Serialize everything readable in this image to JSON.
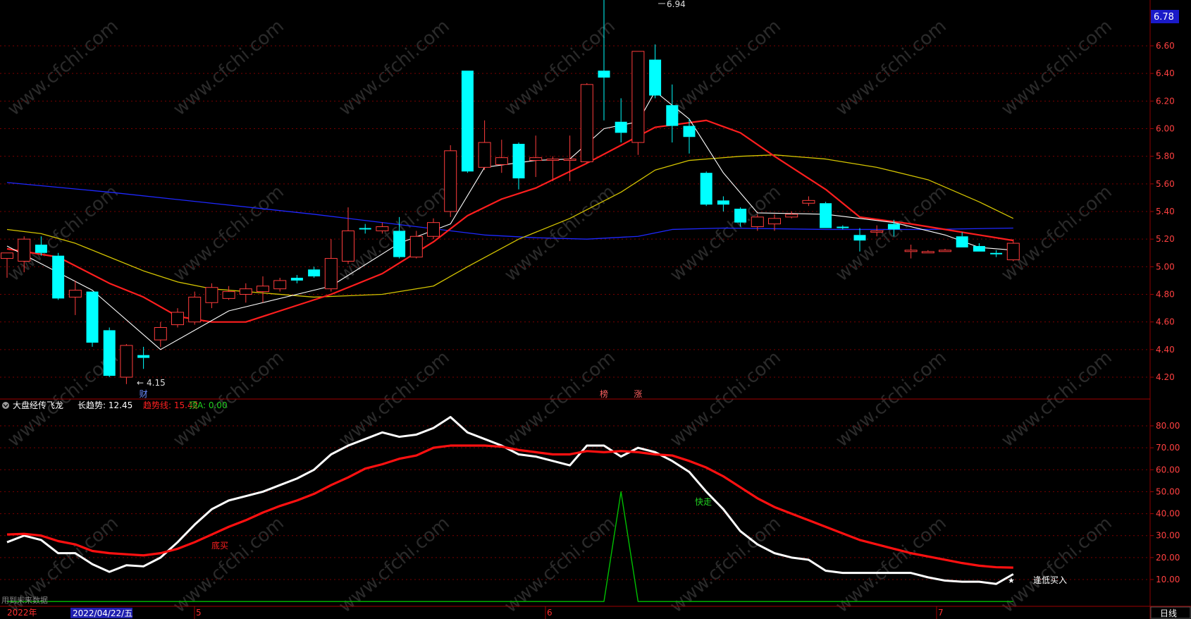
{
  "colors": {
    "bg": "#000000",
    "up": "#ff3c3c",
    "down": "#00ffff",
    "ma5": "#ffffff",
    "ma10": "#ff1e1e",
    "ma20": "#d4c400",
    "ma60": "#1e28ff",
    "grid": "#7a0000",
    "axis_text": "#ff4040",
    "signal": "#00c000",
    "white_line": "#ffffff",
    "red_line": "#ff1010"
  },
  "price_panel": {
    "current_price": "6.78",
    "high_label": "6.94",
    "low_label": "4.15",
    "y_ticks": [
      "6.60",
      "6.40",
      "6.20",
      "6.00",
      "5.80",
      "5.60",
      "5.40",
      "5.20",
      "5.00",
      "4.80",
      "4.60",
      "4.40",
      "4.20"
    ],
    "markers": [
      {
        "text": "财",
        "idx": 8
      },
      {
        "text": "榜",
        "idx": 35
      },
      {
        "text": "涨",
        "idx": 37
      }
    ]
  },
  "indicator_panel": {
    "title": "大盘经传飞龙",
    "long_trend_label": "长趋势: 12.45",
    "trend_line_label": "趋势线: 15.42",
    "top_label": "顶A: 0.00",
    "y_ticks": [
      "80.00",
      "70.00",
      "60.00",
      "50.00",
      "40.00",
      "30.00",
      "20.00",
      "10.00"
    ],
    "annotations": {
      "bottom_buy": "底买",
      "fast_exit": "快走",
      "low_buy": "逢低买入"
    },
    "future_data_note": "用到未来数据"
  },
  "time_axis": {
    "year_label": "2022年",
    "cursor_date": "2022/04/22/五",
    "month_labels": [
      "5",
      "6",
      "7"
    ],
    "period": "日线"
  },
  "chart_data": [
    {
      "type": "candlestick",
      "ylim": [
        4.12,
        6.97
      ],
      "candles": [
        {
          "o": 5.06,
          "h": 5.1,
          "l": 4.92,
          "c": 5.1
        },
        {
          "o": 5.04,
          "h": 5.22,
          "l": 4.96,
          "c": 5.2
        },
        {
          "o": 5.16,
          "h": 5.22,
          "l": 5.08,
          "c": 5.1
        },
        {
          "o": 5.08,
          "h": 5.1,
          "l": 4.76,
          "c": 4.77
        },
        {
          "o": 4.78,
          "h": 4.9,
          "l": 4.65,
          "c": 4.83
        },
        {
          "o": 4.82,
          "h": 4.82,
          "l": 4.42,
          "c": 4.45
        },
        {
          "o": 4.54,
          "h": 4.56,
          "l": 4.2,
          "c": 4.21
        },
        {
          "o": 4.2,
          "h": 4.44,
          "l": 4.15,
          "c": 4.43
        },
        {
          "o": 4.36,
          "h": 4.42,
          "l": 4.26,
          "c": 4.34
        },
        {
          "o": 4.47,
          "h": 4.6,
          "l": 4.42,
          "c": 4.56
        },
        {
          "o": 4.58,
          "h": 4.7,
          "l": 4.56,
          "c": 4.67
        },
        {
          "o": 4.6,
          "h": 4.82,
          "l": 4.58,
          "c": 4.78
        },
        {
          "o": 4.74,
          "h": 4.88,
          "l": 4.7,
          "c": 4.85
        },
        {
          "o": 4.77,
          "h": 4.86,
          "l": 4.76,
          "c": 4.82
        },
        {
          "o": 4.8,
          "h": 4.88,
          "l": 4.74,
          "c": 4.84
        },
        {
          "o": 4.82,
          "h": 4.93,
          "l": 4.74,
          "c": 4.86
        },
        {
          "o": 4.84,
          "h": 4.92,
          "l": 4.82,
          "c": 4.9
        },
        {
          "o": 4.92,
          "h": 4.94,
          "l": 4.88,
          "c": 4.9
        },
        {
          "o": 4.98,
          "h": 5.0,
          "l": 4.92,
          "c": 4.93
        },
        {
          "o": 4.84,
          "h": 5.2,
          "l": 4.82,
          "c": 5.06
        },
        {
          "o": 5.04,
          "h": 5.43,
          "l": 5.02,
          "c": 5.26
        },
        {
          "o": 5.28,
          "h": 5.31,
          "l": 5.24,
          "c": 5.27
        },
        {
          "o": 5.26,
          "h": 5.32,
          "l": 5.24,
          "c": 5.29
        },
        {
          "o": 5.26,
          "h": 5.36,
          "l": 5.06,
          "c": 5.07
        },
        {
          "o": 5.07,
          "h": 5.26,
          "l": 5.06,
          "c": 5.22
        },
        {
          "o": 5.22,
          "h": 5.35,
          "l": 5.2,
          "c": 5.32
        },
        {
          "o": 5.4,
          "h": 5.88,
          "l": 5.36,
          "c": 5.84
        },
        {
          "o": 6.42,
          "h": 6.42,
          "l": 5.68,
          "c": 5.69
        },
        {
          "o": 5.72,
          "h": 6.06,
          "l": 5.7,
          "c": 5.9
        },
        {
          "o": 5.74,
          "h": 5.92,
          "l": 5.68,
          "c": 5.79
        },
        {
          "o": 5.89,
          "h": 5.9,
          "l": 5.56,
          "c": 5.64
        },
        {
          "o": 5.77,
          "h": 5.95,
          "l": 5.65,
          "c": 5.79
        },
        {
          "o": 5.77,
          "h": 5.8,
          "l": 5.62,
          "c": 5.78
        },
        {
          "o": 5.77,
          "h": 5.95,
          "l": 5.62,
          "c": 5.78
        },
        {
          "o": 5.76,
          "h": 6.33,
          "l": 5.75,
          "c": 6.32
        },
        {
          "o": 6.42,
          "h": 6.94,
          "l": 6.06,
          "c": 6.37
        },
        {
          "o": 6.05,
          "h": 6.22,
          "l": 5.9,
          "c": 5.97
        },
        {
          "o": 5.9,
          "h": 6.56,
          "l": 5.81,
          "c": 6.56
        },
        {
          "o": 6.5,
          "h": 6.61,
          "l": 6.22,
          "c": 6.24
        },
        {
          "o": 6.17,
          "h": 6.32,
          "l": 5.9,
          "c": 6.02
        },
        {
          "o": 6.02,
          "h": 6.07,
          "l": 5.82,
          "c": 5.94
        },
        {
          "o": 5.68,
          "h": 5.69,
          "l": 5.44,
          "c": 5.45
        },
        {
          "o": 5.48,
          "h": 5.51,
          "l": 5.4,
          "c": 5.45
        },
        {
          "o": 5.42,
          "h": 5.43,
          "l": 5.29,
          "c": 5.32
        },
        {
          "o": 5.29,
          "h": 5.38,
          "l": 5.26,
          "c": 5.36
        },
        {
          "o": 5.31,
          "h": 5.38,
          "l": 5.26,
          "c": 5.35
        },
        {
          "o": 5.36,
          "h": 5.4,
          "l": 5.35,
          "c": 5.38
        },
        {
          "o": 5.46,
          "h": 5.51,
          "l": 5.44,
          "c": 5.48
        },
        {
          "o": 5.46,
          "h": 5.47,
          "l": 5.28,
          "c": 5.28
        },
        {
          "o": 5.29,
          "h": 5.3,
          "l": 5.27,
          "c": 5.28
        },
        {
          "o": 5.23,
          "h": 5.28,
          "l": 5.11,
          "c": 5.19
        },
        {
          "o": 5.25,
          "h": 5.3,
          "l": 5.22,
          "c": 5.26
        },
        {
          "o": 5.31,
          "h": 5.34,
          "l": 5.22,
          "c": 5.27
        },
        {
          "o": 5.11,
          "h": 5.16,
          "l": 5.06,
          "c": 5.12
        },
        {
          "o": 5.1,
          "h": 5.12,
          "l": 5.1,
          "c": 5.11
        },
        {
          "o": 5.11,
          "h": 5.13,
          "l": 5.11,
          "c": 5.12
        },
        {
          "o": 5.22,
          "h": 5.25,
          "l": 5.14,
          "c": 5.14
        },
        {
          "o": 5.15,
          "h": 5.17,
          "l": 5.11,
          "c": 5.11
        },
        {
          "o": 5.1,
          "h": 5.12,
          "l": 5.07,
          "c": 5.09
        },
        {
          "o": 5.05,
          "h": 5.2,
          "l": 5.04,
          "c": 5.17
        }
      ],
      "ma5": [
        [
          0,
          5.15
        ],
        [
          5,
          4.83
        ],
        [
          9,
          4.4
        ],
        [
          13,
          4.68
        ],
        [
          19,
          4.86
        ],
        [
          23,
          5.17
        ],
        [
          26,
          5.31
        ],
        [
          28,
          5.72
        ],
        [
          31,
          5.77
        ],
        [
          33,
          5.78
        ],
        [
          35,
          6.0
        ],
        [
          37,
          6.05
        ],
        [
          38,
          6.27
        ],
        [
          40,
          6.07
        ],
        [
          42,
          5.68
        ],
        [
          44,
          5.39
        ],
        [
          48,
          5.38
        ],
        [
          52,
          5.32
        ],
        [
          55,
          5.23
        ],
        [
          57,
          5.14
        ],
        [
          59,
          5.12
        ]
      ],
      "ma10": [
        [
          0,
          5.13
        ],
        [
          3,
          5.07
        ],
        [
          6,
          4.88
        ],
        [
          8,
          4.78
        ],
        [
          10,
          4.64
        ],
        [
          12,
          4.6
        ],
        [
          14,
          4.6
        ],
        [
          16,
          4.68
        ],
        [
          19,
          4.8
        ],
        [
          22,
          4.95
        ],
        [
          25,
          5.18
        ],
        [
          27,
          5.37
        ],
        [
          29,
          5.49
        ],
        [
          31,
          5.57
        ],
        [
          34,
          5.75
        ],
        [
          36,
          5.88
        ],
        [
          38,
          6.01
        ],
        [
          41,
          6.06
        ],
        [
          43,
          5.97
        ],
        [
          45,
          5.8
        ],
        [
          48,
          5.56
        ],
        [
          50,
          5.36
        ],
        [
          53,
          5.31
        ],
        [
          56,
          5.25
        ],
        [
          59,
          5.19
        ]
      ],
      "ma20": [
        [
          0,
          5.27
        ],
        [
          2,
          5.24
        ],
        [
          4,
          5.17
        ],
        [
          6,
          5.07
        ],
        [
          8,
          4.97
        ],
        [
          10,
          4.89
        ],
        [
          12,
          4.84
        ],
        [
          14,
          4.82
        ],
        [
          18,
          4.78
        ],
        [
          22,
          4.8
        ],
        [
          25,
          4.86
        ],
        [
          27,
          5.0
        ],
        [
          30,
          5.2
        ],
        [
          33,
          5.35
        ],
        [
          36,
          5.54
        ],
        [
          38,
          5.7
        ],
        [
          40,
          5.77
        ],
        [
          43,
          5.8
        ],
        [
          45,
          5.81
        ],
        [
          48,
          5.78
        ],
        [
          51,
          5.72
        ],
        [
          54,
          5.63
        ],
        [
          57,
          5.47
        ],
        [
          59,
          5.35
        ]
      ],
      "ma60": [
        [
          0,
          5.61
        ],
        [
          6,
          5.54
        ],
        [
          12,
          5.46
        ],
        [
          18,
          5.38
        ],
        [
          24,
          5.29
        ],
        [
          28,
          5.23
        ],
        [
          31,
          5.21
        ],
        [
          34,
          5.2
        ],
        [
          37,
          5.22
        ],
        [
          39,
          5.27
        ],
        [
          42,
          5.28
        ],
        [
          48,
          5.27
        ],
        [
          54,
          5.27
        ],
        [
          59,
          5.28
        ]
      ]
    },
    {
      "type": "line",
      "ylim": [
        0,
        90
      ],
      "series": [
        {
          "name": "长趋势",
          "values": [
            27,
            30,
            28,
            22,
            22,
            17,
            13.5,
            16.5,
            16,
            20,
            27,
            35,
            42,
            46,
            48,
            50,
            53,
            56,
            60,
            67,
            71,
            74,
            77,
            75,
            76,
            79,
            84,
            77,
            74,
            71,
            67,
            66,
            64,
            62,
            71,
            71,
            66,
            70,
            68,
            64,
            59,
            50,
            42,
            32,
            26,
            22,
            20,
            19,
            14,
            13,
            13,
            13,
            13,
            13,
            11,
            9.5,
            9,
            9,
            8,
            12.45
          ]
        },
        {
          "name": "趋势线",
          "values": [
            30.5,
            30.8,
            30,
            27.5,
            26,
            23,
            22,
            21.5,
            21,
            22,
            24,
            27,
            30.5,
            34,
            37,
            40.5,
            43.5,
            46,
            49,
            53,
            56.5,
            60.5,
            62.5,
            65,
            66.5,
            70,
            71,
            71,
            71,
            70.5,
            69,
            68,
            67,
            67,
            68.5,
            68,
            68.5,
            68,
            67,
            66.5,
            64,
            61,
            57,
            52,
            47,
            43,
            40,
            37,
            34,
            31,
            28,
            26,
            24,
            22,
            20.5,
            19,
            17.5,
            16.3,
            15.6,
            15.42
          ]
        },
        {
          "name": "顶A",
          "values": [
            0,
            0,
            0,
            0,
            0,
            0,
            0,
            0,
            0,
            0,
            0,
            0,
            0,
            0,
            0,
            0,
            0,
            0,
            0,
            0,
            0,
            0,
            0,
            0,
            0,
            0,
            0,
            0,
            0,
            0,
            0,
            0,
            0,
            0,
            0,
            0,
            50,
            0,
            0,
            0,
            0,
            0,
            0,
            0,
            0,
            0,
            0,
            0,
            0,
            0,
            0,
            0,
            0,
            0,
            0,
            0,
            0,
            0,
            0,
            0
          ]
        }
      ]
    }
  ]
}
